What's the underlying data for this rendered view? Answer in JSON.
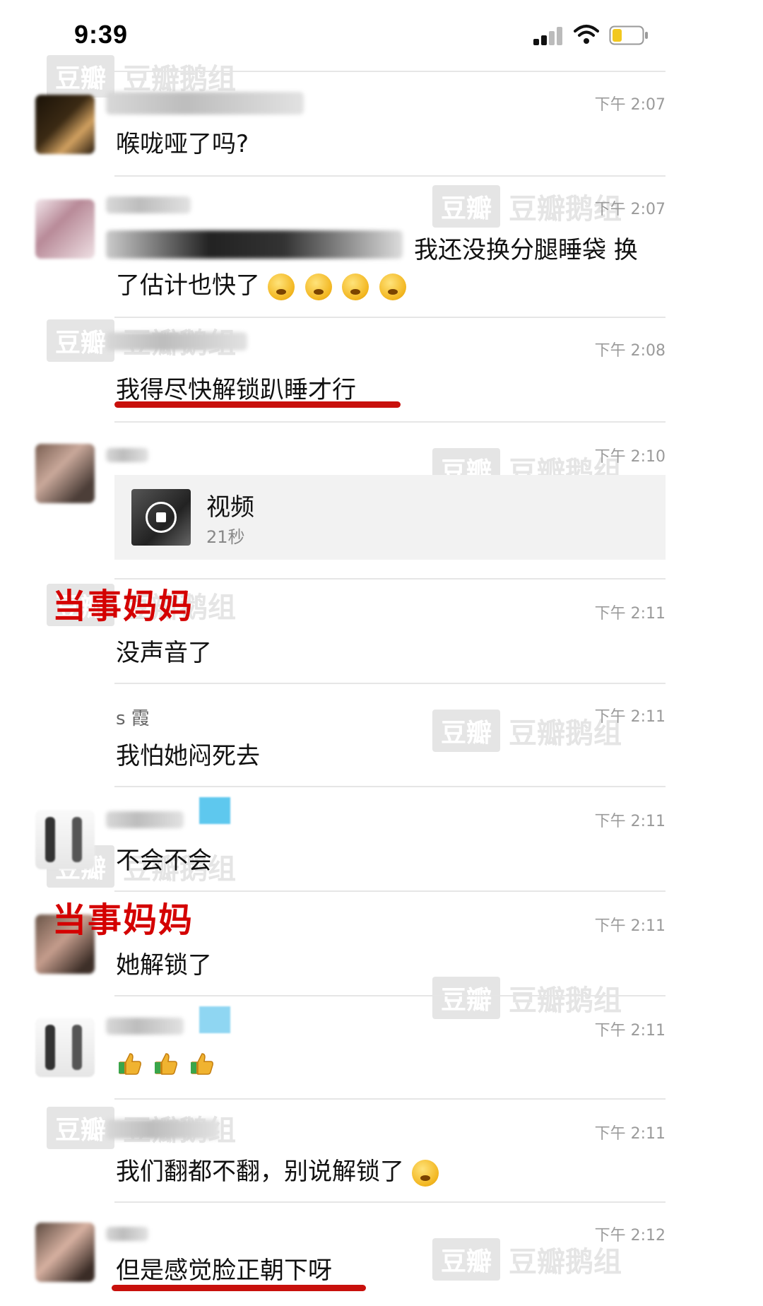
{
  "status": {
    "time": "9:39"
  },
  "watermark": {
    "box": "豆瓣",
    "text": "豆瓣鹅组"
  },
  "labels": {
    "mom": "当事妈妈"
  },
  "messages": [
    {
      "sender": "",
      "time": "下午 2:07",
      "text": "喉咙哑了吗?"
    },
    {
      "sender": "",
      "time": "下午 2:07",
      "text_line1": "我还没换分腿睡袋 换",
      "text_line2": "了估计也快了",
      "emojis": [
        "grinning-sweat",
        "sleepy",
        "sleepy",
        "sleepy"
      ]
    },
    {
      "sender": "",
      "time": "下午 2:08",
      "text": "我得尽快解锁趴睡才行"
    },
    {
      "sender": "",
      "time": "下午 2:10",
      "video": {
        "title": "视频",
        "duration": "21秒"
      }
    },
    {
      "sender": "",
      "time": "下午 2:11",
      "text": "没声音了"
    },
    {
      "sender": "s 霞",
      "time": "下午 2:11",
      "text": "我怕她闷死去"
    },
    {
      "sender": "",
      "time": "下午 2:11",
      "text": "不会不会"
    },
    {
      "sender": "",
      "time": "下午 2:11",
      "text": "她解锁了"
    },
    {
      "sender": "",
      "time": "下午 2:11",
      "emojis": [
        "thumbs-up",
        "thumbs-up",
        "thumbs-up"
      ]
    },
    {
      "sender": "",
      "time": "下午 2:11",
      "text": "我们翻都不翻，别说解锁了"
    },
    {
      "sender": "",
      "time": "下午 2:12",
      "text": "但是感觉脸正朝下呀"
    }
  ],
  "colors": {
    "accent_red": "#c8100c",
    "label_red": "#d40000",
    "timestamp": "#9a9a9a"
  }
}
